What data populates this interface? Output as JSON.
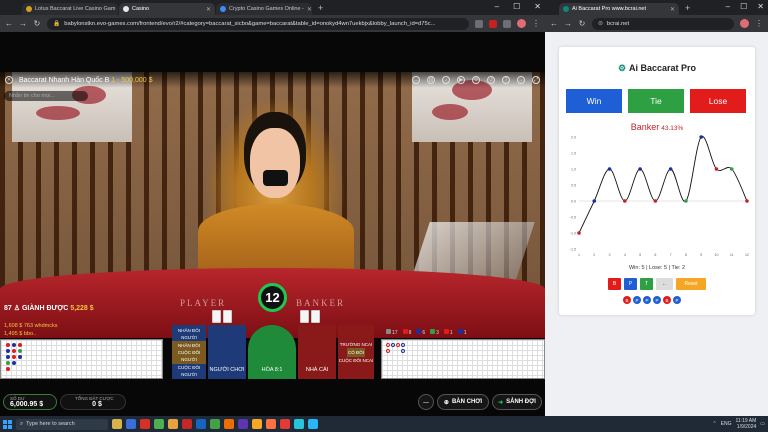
{
  "browser_left": {
    "tabs": [
      {
        "title": "Lotus Baccarat Live Casino Gam"
      },
      {
        "title": "Casino"
      },
      {
        "title": "Crypto Casino Games Online -"
      }
    ],
    "url": "babylonstkn.evo-games.com/frontend/evo/r2/#category=baccarat_sicbo&game=baccarat&table_id=onokyd4wn7uekbjx&lobby_launch_id=d75c..."
  },
  "browser_right": {
    "tabs": [
      {
        "title": "Ai Baccarat Pro www.bcrai.net"
      }
    ],
    "url": "bcrai.net"
  },
  "game": {
    "title": "Baccarat Nhanh Hàn Quốc B",
    "title_limits": "1 - 500,000 $",
    "chat_placeholder": "Nhắn tin cho mọi...",
    "wins_prefix": "87",
    "wins_label": "GIÀNH ĐƯỢC",
    "wins_amount": "5,228 $",
    "players_line1": "1,608 $ 763 whdmcks",
    "players_line2": "1,495 $ bbo..",
    "table_text_player": "PLAYER",
    "table_text_banker": "BANKER",
    "timer": "12",
    "bet_spots": {
      "player_pair_top": "NHÂN ĐÔI NGƯỜI",
      "player_pair_mid": "NHÂN ĐÔI CUỘC ĐÔI NGƯỜI",
      "player_pair_bottom": "CUỘC ĐÔI NGƯỜI",
      "player": "NGƯỜI CHƠI",
      "tie": "HÒA 8:1",
      "banker": "NHÀ CÁI",
      "banker_pair_top": "TRƯỜNG NCAI",
      "banker_pair_mid": "CÓ ĐÔI",
      "banker_pair_bottom": "CUỘC ĐÔI NCAI"
    },
    "summary": {
      "total": "17",
      "banker": "8",
      "player": "6",
      "tie": "3",
      "b_pair": "1",
      "p_pair": "1"
    },
    "balance_label": "SỐ DƯ",
    "balance": "6,000.95 $",
    "total_bet_label": "TỔNG ĐẶT CƯỢC",
    "total_bet": "0 $",
    "btn_play": "BÀN CHƠI",
    "btn_lobby": "SẢNH ĐỢI"
  },
  "app": {
    "title": "Ai Baccarat Pro",
    "btn_win": "Win",
    "btn_tie": "Tie",
    "btn_lose": "Lose",
    "prediction": "Banker",
    "probability": "43.13%",
    "stats": "Win: 5 | Lose: 5 | Tie: 2",
    "controls": [
      "B",
      "P",
      "T",
      "←",
      "Reset"
    ],
    "history": [
      "B",
      "P",
      "P",
      "P",
      "B",
      "P"
    ]
  },
  "chart_data": {
    "type": "line",
    "title": "",
    "xlabel": "",
    "ylabel": "",
    "x": [
      1,
      2,
      3,
      4,
      5,
      6,
      7,
      8,
      9,
      10,
      11,
      12
    ],
    "categories": [
      "1",
      "2",
      "3",
      "4",
      "5",
      "6",
      "7",
      "8",
      "9",
      "10",
      "11",
      "12"
    ],
    "series": [
      {
        "values": [
          -1,
          0,
          1,
          0,
          1,
          0,
          1,
          0,
          2,
          1,
          1,
          0
        ]
      }
    ],
    "point_colors": [
      "#c3232a",
      "#1b2fa3",
      "#1b2fa3",
      "#c3232a",
      "#1b2fa3",
      "#c3232a",
      "#1b2fa3",
      "#2ea043",
      "#1b2fa3",
      "#c3232a",
      "#2ea043",
      "#c3232a"
    ],
    "ylim": [
      -1.5,
      2.0
    ],
    "yticks": [
      "2.0",
      "1.5",
      "1.0",
      "0.5",
      "0.0",
      "-0.5",
      "-1.0",
      "-1.5"
    ],
    "grid": false
  },
  "taskbar": {
    "search": "Type here to search",
    "lang": "ENG",
    "time": "11:19 AM",
    "date": "1/9/2024"
  },
  "colors": {
    "win": "#1f5fd6",
    "tie": "#2ea043",
    "lose": "#e21b1b",
    "banker": "#c3232a",
    "player": "#1b2fa3"
  }
}
